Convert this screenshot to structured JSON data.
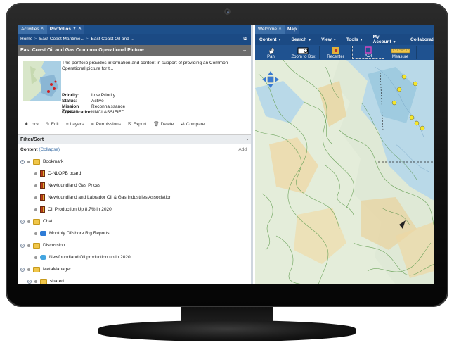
{
  "left": {
    "tabs": [
      {
        "label": "Activities",
        "close": "✕"
      },
      {
        "label": "Portfolios",
        "close": "✕"
      }
    ],
    "breadcrumb": [
      "Home",
      "East Coast Maritime...",
      "East Coast Oil and ..."
    ],
    "header_title": "East Coast Oil and Gas Common Operational Picture",
    "description": "This portfolio provides information and content in support of providing an Common Operational picture for t...",
    "details": [
      {
        "key": "Priority:",
        "value": "Low Priority"
      },
      {
        "key": "Status:",
        "value": "Active"
      },
      {
        "key": "Mission Type:",
        "value": "Reconnaissance"
      },
      {
        "key": "Classification:",
        "value": "UNCLASSIFIED"
      }
    ],
    "actions": [
      "Lock",
      "Edit",
      "Layers",
      "Permissions",
      "Export",
      "Delete",
      "Compare"
    ],
    "filter_label": "Filter/Sort",
    "content_label": "Content",
    "collapse_label": "(Collapse)",
    "add_label": "Add",
    "tree": [
      {
        "label": "Bookmark",
        "icon": "folder-icon",
        "level": 0
      },
      {
        "label": "C-NLOPB board",
        "icon": "bookmark-icon",
        "level": 1
      },
      {
        "label": "Newfoundland Gas Prices",
        "icon": "bookmark-icon",
        "level": 1
      },
      {
        "label": "Newfoundland and Labrador Oil & Gas Industries Association",
        "icon": "bookmark-icon",
        "level": 1
      },
      {
        "label": "Oil Production Up 8.7% in 2020",
        "icon": "bookmark-icon",
        "level": 1
      },
      {
        "label": "Chat",
        "icon": "folder-icon",
        "level": 0
      },
      {
        "label": "Monthly Offshore Rig Reports",
        "icon": "chat-icon",
        "level": 1
      },
      {
        "label": "Discussion",
        "icon": "folder-icon",
        "level": 0
      },
      {
        "label": "Newfoundland Oil production up in 2020",
        "icon": "discussion-icon",
        "level": 1
      },
      {
        "label": "MetaManager",
        "icon": "folder-icon",
        "level": 0
      },
      {
        "label": "shared",
        "icon": "folder-icon",
        "level": 1
      }
    ]
  },
  "right": {
    "tabs": [
      {
        "label": "Welcome",
        "close": "✕"
      },
      {
        "label": "Map",
        "close": ""
      }
    ],
    "menu": [
      "Content",
      "Search",
      "View",
      "Tools",
      "My Account",
      "Collaborati"
    ],
    "tools": [
      "Pan",
      "Zoom to Box",
      "Recenter",
      "AOI",
      "Measure"
    ]
  },
  "colors": {
    "tab_bar": "#1d4f8a",
    "header_gray": "#6c6c6c",
    "map_water": "#b9d9e8",
    "map_land": "#dbe9d3"
  }
}
